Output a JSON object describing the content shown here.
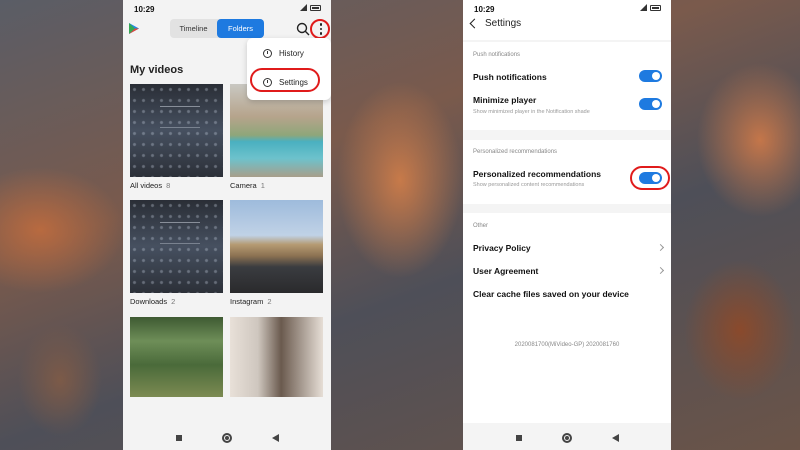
{
  "left_screen": {
    "status_time": "10:29",
    "tabs": [
      {
        "label": "Timeline",
        "selected": false
      },
      {
        "label": "Folders",
        "selected": true
      }
    ],
    "section_title": "My videos",
    "menu": {
      "items": [
        {
          "label": "History",
          "icon": "history-icon"
        },
        {
          "label": "Settings",
          "icon": "settings-icon"
        }
      ]
    },
    "folders": [
      {
        "name": "All videos",
        "count": "8"
      },
      {
        "name": "Camera",
        "count": "1"
      },
      {
        "name": "Downloads",
        "count": "2"
      },
      {
        "name": "Instagram",
        "count": "2"
      }
    ]
  },
  "right_screen": {
    "status_time": "10:29",
    "title": "Settings",
    "groups": [
      {
        "label": "Push notifications",
        "rows": [
          {
            "title": "Push notifications",
            "subtitle": "",
            "toggle_on": true
          },
          {
            "title": "Minimize player",
            "subtitle": "Show minimized player in the Notification shade",
            "toggle_on": true
          }
        ]
      },
      {
        "label": "Personalized recommendations",
        "rows": [
          {
            "title": "Personalized recommendations",
            "subtitle": "Show personalized content recommendations",
            "toggle_on": true
          }
        ]
      },
      {
        "label": "Other",
        "rows": [
          {
            "title": "Privacy Policy"
          },
          {
            "title": "User Agreement"
          },
          {
            "title": "Clear cache files saved on your device"
          }
        ]
      }
    ],
    "version": "2020081700(MiVideo-GP) 2020081760"
  },
  "colors": {
    "accent": "#1e7ae0",
    "highlight_ring": "#e01b1b"
  }
}
